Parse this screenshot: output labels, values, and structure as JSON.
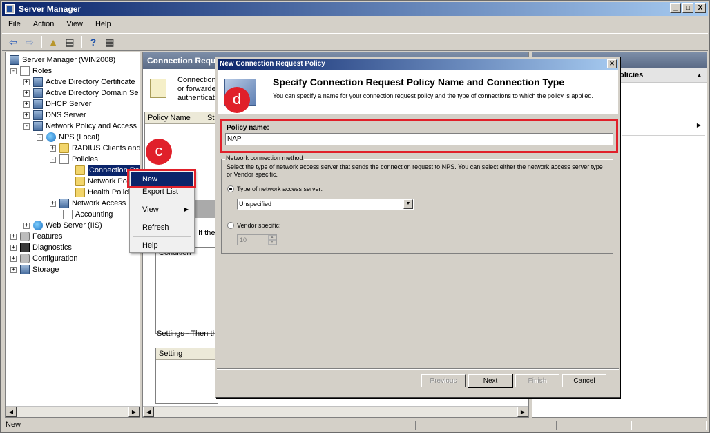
{
  "window": {
    "title": "Server Manager",
    "caption_buttons": [
      "_",
      "□",
      "X"
    ]
  },
  "menu": [
    "File",
    "Action",
    "View",
    "Help"
  ],
  "toolbar_icons": [
    "back-icon",
    "forward-icon",
    "up-icon",
    "show-hide-icon",
    "help-icon",
    "properties-icon"
  ],
  "tree": {
    "root": "Server Manager (WIN2008)",
    "roles": "Roles",
    "adcs": "Active Directory Certificate",
    "adds": "Active Directory Domain Se",
    "dhcp": "DHCP Server",
    "dns": "DNS Server",
    "npa": "Network Policy and Access",
    "nps_local": "NPS (Local)",
    "radius": "RADIUS Clients and",
    "policies": "Policies",
    "conn_req": "Connection Re",
    "network_pol": "Network Poli",
    "health_pol": "Health Policie",
    "network_access": "Network Access",
    "accounting": "Accounting",
    "web_server": "Web Server (IIS)",
    "features": "Features",
    "diagnostics": "Diagnostics",
    "configuration": "Configuration",
    "storage": "Storage"
  },
  "middle": {
    "header": "Connection Reques",
    "info_lines": [
      "Connection",
      "or forwarded",
      "authenticatio"
    ],
    "col_policy_name": "Policy Name",
    "col_st": "St",
    "if_the": "If the",
    "condition": "Condition",
    "settings_label": "Settings - Then the",
    "col_setting": "Setting"
  },
  "right": {
    "sub": "olicies"
  },
  "status": "New",
  "context_menu": {
    "new": "New",
    "export": "Export List",
    "view": "View",
    "refresh": "Refresh",
    "help": "Help"
  },
  "annotations": {
    "c": "c",
    "d": "d"
  },
  "dialog": {
    "title": "New Connection Request Policy",
    "heading": "Specify Connection Request Policy Name and Connection Type",
    "subheading": "You can specify a name for your connection request policy and the type of connections to which the policy is applied.",
    "policy_name_label": "Policy name:",
    "policy_name_value": "NAP",
    "group_label": "Network connection method",
    "group_desc": "Select the type of network access server that sends the connection request to NPS. You can select either the network access server type or Vendor specific.",
    "radio_type_label": "Type of network access server:",
    "type_select_value": "Unspecified",
    "radio_vendor_label": "Vendor specific:",
    "vendor_value": "10",
    "buttons": {
      "previous": "Previous",
      "next": "Next",
      "finish": "Finish",
      "cancel": "Cancel"
    }
  },
  "colors": {
    "title_start": "#0a246a",
    "title_end": "#a6caf0",
    "annotation_red": "#e0202a",
    "selection": "#0a246a"
  }
}
